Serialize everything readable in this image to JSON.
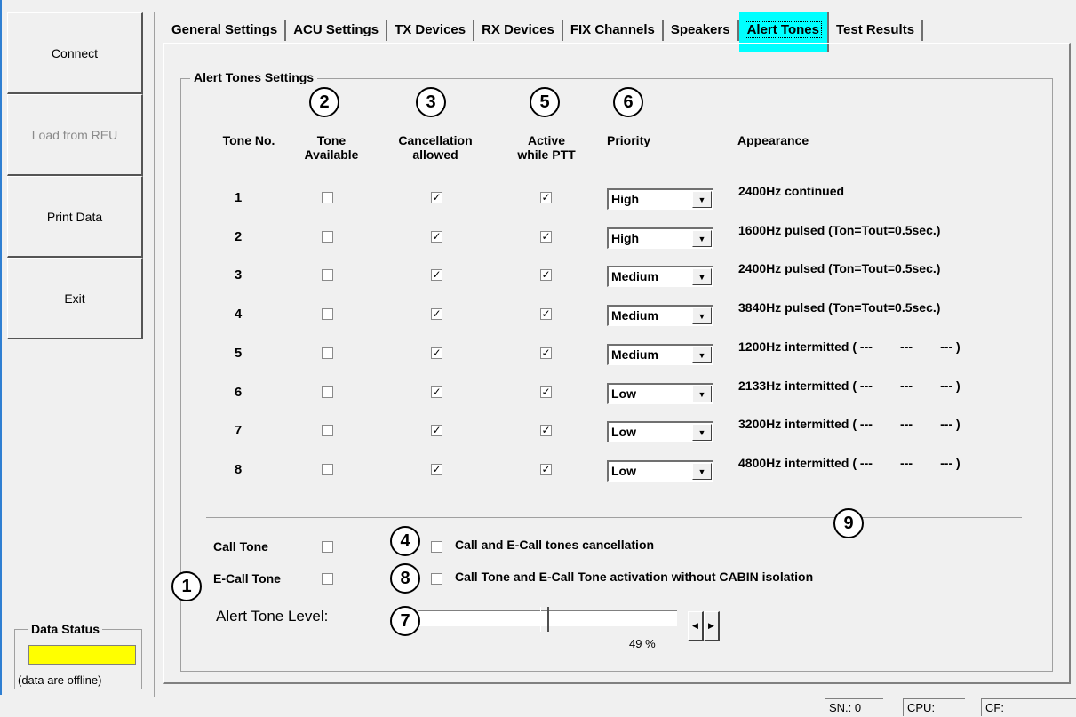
{
  "sidebar": {
    "connect": "Connect",
    "load_from_reu": "Load from REU",
    "print_data": "Print Data",
    "exit": "Exit",
    "data_status_label": "Data Status",
    "data_status_text": "(data are offline)",
    "data_status_color": "#ffff00"
  },
  "tabs": [
    "General Settings",
    "ACU Settings",
    "TX Devices",
    "RX Devices",
    "FIX Channels",
    "Speakers",
    "Alert Tones",
    "Test Results"
  ],
  "active_tab": "Alert Tones",
  "group": {
    "title": "Alert Tones Settings",
    "headers": {
      "tone_no": "Tone No.",
      "tone_available_1": "Tone",
      "tone_available_2": "Available",
      "cancellation_1": "Cancellation",
      "cancellation_2": "allowed",
      "active_ptt_1": "Active",
      "active_ptt_2": "while PTT",
      "priority": "Priority",
      "appearance": "Appearance"
    },
    "rows": [
      {
        "no": "1",
        "available": false,
        "cancel": true,
        "active_ptt": true,
        "priority": "High",
        "appearance": "2400Hz continued"
      },
      {
        "no": "2",
        "available": false,
        "cancel": true,
        "active_ptt": true,
        "priority": "High",
        "appearance": "1600Hz pulsed (Ton=Tout=0.5sec.)"
      },
      {
        "no": "3",
        "available": false,
        "cancel": true,
        "active_ptt": true,
        "priority": "Medium",
        "appearance": "2400Hz pulsed (Ton=Tout=0.5sec.)"
      },
      {
        "no": "4",
        "available": false,
        "cancel": true,
        "active_ptt": true,
        "priority": "Medium",
        "appearance": "3840Hz pulsed (Ton=Tout=0.5sec.)"
      },
      {
        "no": "5",
        "available": false,
        "cancel": true,
        "active_ptt": true,
        "priority": "Medium",
        "appearance": "1200Hz intermitted ( ---        ---        --- )"
      },
      {
        "no": "6",
        "available": false,
        "cancel": true,
        "active_ptt": true,
        "priority": "Low",
        "appearance": "2133Hz intermitted ( ---        ---        --- )"
      },
      {
        "no": "7",
        "available": false,
        "cancel": true,
        "active_ptt": true,
        "priority": "Low",
        "appearance": "3200Hz intermitted ( ---        ---        --- )"
      },
      {
        "no": "8",
        "available": false,
        "cancel": true,
        "active_ptt": true,
        "priority": "Low",
        "appearance": "4800Hz intermitted ( ---        ---        --- )"
      }
    ],
    "call_tone": "Call Tone",
    "ecall_tone": "E-Call Tone",
    "call_cancellation": "Call and E-Call tones cancellation",
    "activation_without_isolation": "Call Tone and E-Call Tone activation without CABIN isolation",
    "alert_level_label": "Alert Tone Level:",
    "alert_level_value": 0.49,
    "alert_level_text": "49 %"
  },
  "badges": [
    "1",
    "2",
    "3",
    "4",
    "5",
    "6",
    "7",
    "8",
    "9"
  ],
  "statusbar": {
    "sn": "SN.: 0",
    "cpu": "CPU:",
    "cf": "CF:"
  }
}
